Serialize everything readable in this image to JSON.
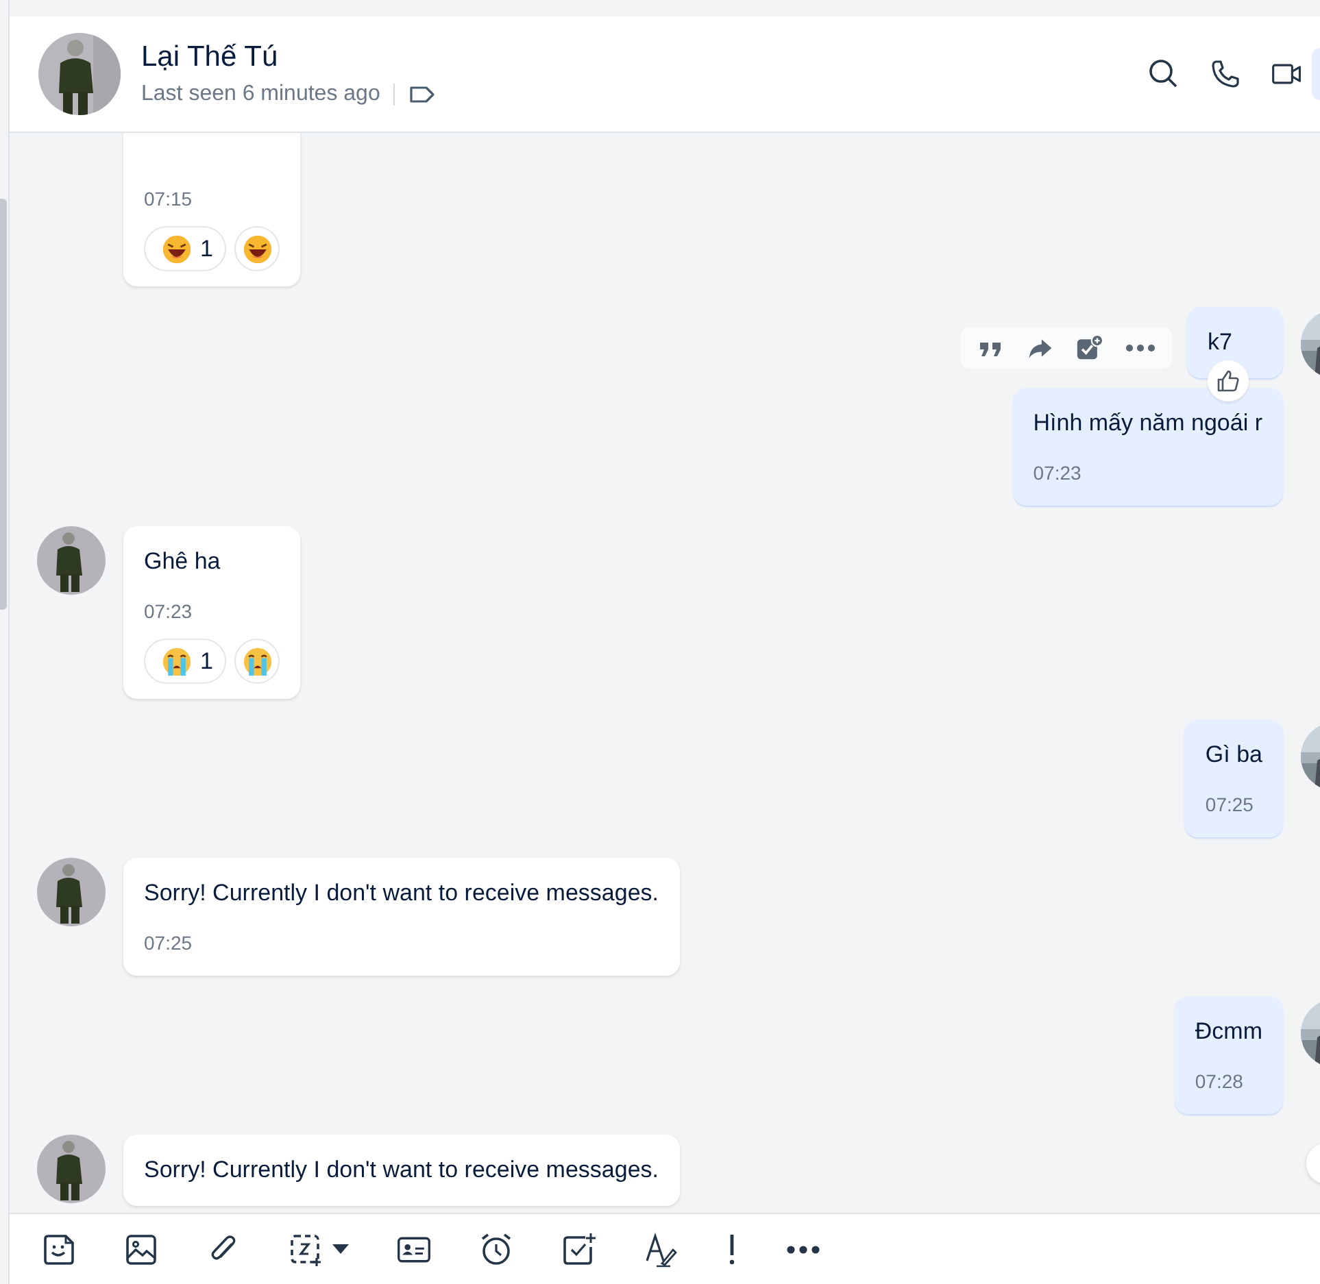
{
  "header": {
    "name": "Lại Thế Tú",
    "status": "Last seen 6 minutes ago"
  },
  "messages": [
    {
      "kind": "incoming",
      "time": "07:15",
      "reaction": {
        "kind": "laugh",
        "count": "1"
      }
    },
    {
      "kind": "outgoing",
      "text": "k7",
      "hovered": true
    },
    {
      "kind": "outgoing",
      "text": "Hình mấy năm ngoái r",
      "time": "07:23"
    },
    {
      "kind": "incoming",
      "text": "Ghê ha",
      "time": "07:23",
      "reaction": {
        "kind": "cry",
        "count": "1"
      }
    },
    {
      "kind": "outgoing",
      "text": "Gì ba",
      "time": "07:25"
    },
    {
      "kind": "incoming",
      "text": "Sorry! Currently I don't want to receive messages.",
      "time": "07:25"
    },
    {
      "kind": "outgoing",
      "text": "Đcmm",
      "time": "07:28"
    },
    {
      "kind": "incoming",
      "text": "Sorry! Currently I don't want to receive messages."
    }
  ]
}
